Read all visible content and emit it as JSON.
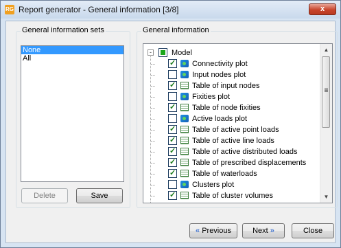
{
  "window": {
    "title": "Report generator - General information [3/8]",
    "app_icon_text": "RG",
    "close_glyph": "x"
  },
  "left_panel": {
    "group_label": "General information sets",
    "sets": [
      {
        "label": "None",
        "selected": true
      },
      {
        "label": "All",
        "selected": false
      }
    ],
    "delete_label": "Delete",
    "save_label": "Save"
  },
  "right_panel": {
    "group_label": "General information",
    "root": {
      "label": "Model",
      "expander": "-",
      "state": "partial"
    },
    "items": [
      {
        "label": "Connectivity plot",
        "checked": true,
        "icon": "plot-icon"
      },
      {
        "label": "Input nodes plot",
        "checked": false,
        "icon": "plot-icon"
      },
      {
        "label": "Table of input nodes",
        "checked": true,
        "icon": "table-icon"
      },
      {
        "label": "Fixities plot",
        "checked": false,
        "icon": "plot-icon"
      },
      {
        "label": "Table of node fixities",
        "checked": true,
        "icon": "table-icon"
      },
      {
        "label": "Active loads plot",
        "checked": false,
        "icon": "plot-icon"
      },
      {
        "label": "Table of active point loads",
        "checked": true,
        "icon": "table-icon"
      },
      {
        "label": "Table of active line loads",
        "checked": true,
        "icon": "table-icon"
      },
      {
        "label": "Table of active distributed loads",
        "checked": true,
        "icon": "table-icon"
      },
      {
        "label": "Table of prescribed displacements",
        "checked": true,
        "icon": "table-icon"
      },
      {
        "label": "Table of waterloads",
        "checked": true,
        "icon": "table-icon"
      },
      {
        "label": "Clusters plot",
        "checked": false,
        "icon": "plot-icon"
      },
      {
        "label": "Table of cluster volumes",
        "checked": true,
        "icon": "table-icon"
      }
    ]
  },
  "footer": {
    "previous_label": "Previous",
    "previous_arrow": "«",
    "next_label": "Next",
    "next_arrow": "»",
    "close_label": "Close"
  }
}
